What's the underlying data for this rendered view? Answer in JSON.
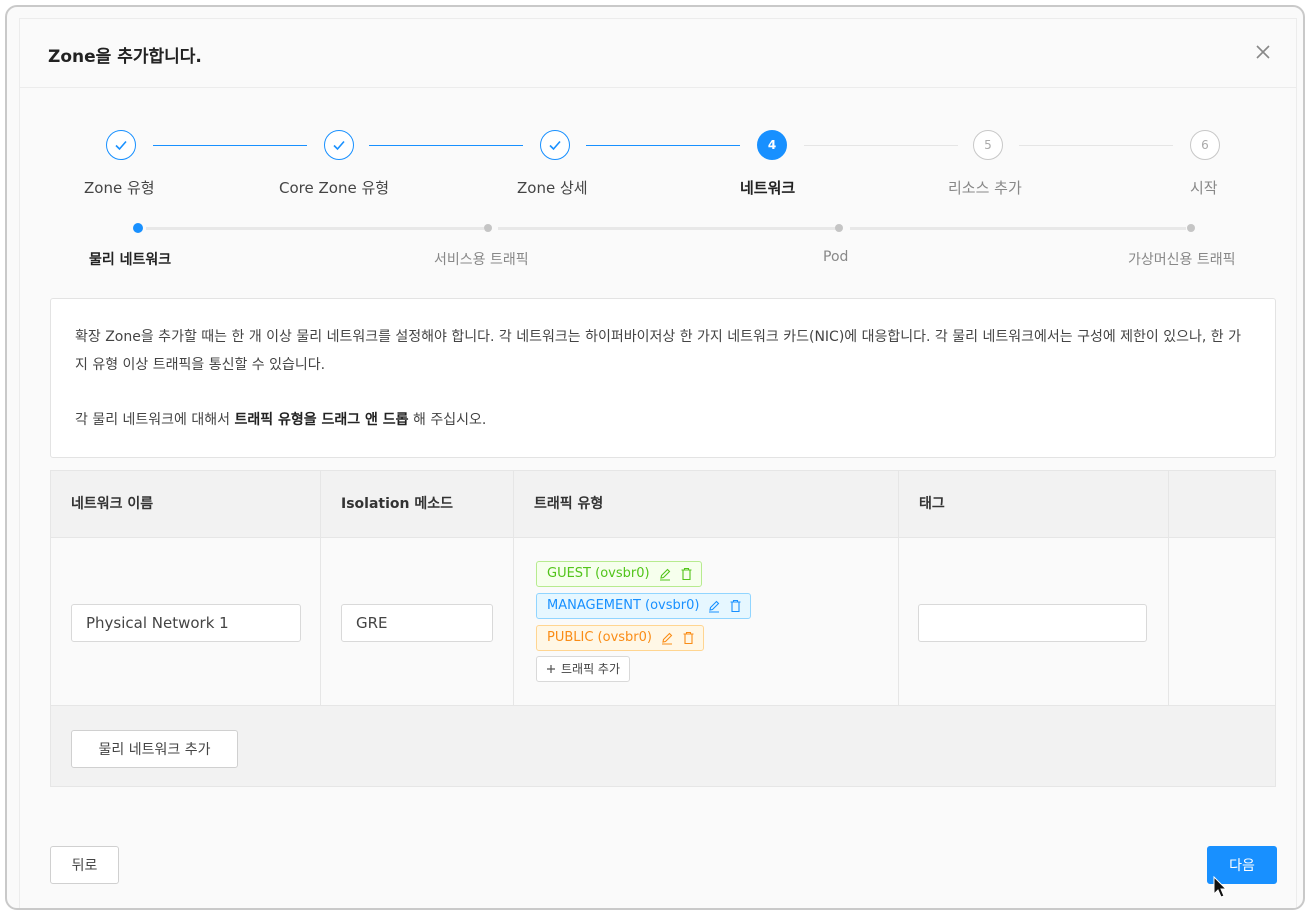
{
  "dialog": {
    "title": "Zone을 추가합니다."
  },
  "steps": [
    {
      "label": "Zone 유형",
      "status": "done"
    },
    {
      "label": "Core Zone 유형",
      "status": "done"
    },
    {
      "label": "Zone 상세",
      "status": "done"
    },
    {
      "label": "네트워크",
      "number": "4",
      "status": "current"
    },
    {
      "label": "리소스 추가",
      "number": "5",
      "status": "wait"
    },
    {
      "label": "시작",
      "number": "6",
      "status": "wait"
    }
  ],
  "substeps": [
    {
      "label": "물리 네트워크",
      "status": "current"
    },
    {
      "label": "서비스용 트래픽",
      "status": "wait"
    },
    {
      "label": "Pod",
      "status": "wait"
    },
    {
      "label": "가상머신용 트래픽",
      "status": "wait"
    }
  ],
  "info": {
    "paragraph1": "확장 Zone을 추가할 때는 한 개 이상 물리 네트워크를 설정해야 합니다. 각 네트워크는 하이퍼바이저상 한 가지 네트워크 카드(NIC)에 대응합니다. 각 물리 네트워크에서는 구성에 제한이 있으나, 한 가지 유형 이상 트래픽을 통신할 수 있습니다.",
    "paragraph2_prefix": "각 물리 네트워크에 대해서 ",
    "paragraph2_bold": "트래픽 유형을 드래그 앤 드롭",
    "paragraph2_suffix": " 해 주십시오."
  },
  "table": {
    "headers": [
      "네트워크 이름",
      "Isolation 메소드",
      "트래픽 유형",
      "태그"
    ],
    "row": {
      "network_name": "Physical Network 1",
      "isolation_method": "GRE",
      "traffic_types": [
        "GUEST (ovsbr0)",
        "MANAGEMENT (ovsbr0)",
        "PUBLIC (ovsbr0)"
      ],
      "tags_value": "",
      "add_traffic_label": "트래픽 추가"
    },
    "add_network_label": "물리 네트워크 추가"
  },
  "footer": {
    "back_label": "뒤로",
    "next_label": "다음"
  },
  "colors": {
    "primary": "#1890ff",
    "guest": "#52c41a",
    "management": "#1890ff",
    "public": "#fa8c16"
  },
  "icons": [
    "check-icon",
    "close-icon",
    "edit-icon",
    "delete-icon",
    "plus-icon",
    "mouse-cursor-icon"
  ]
}
